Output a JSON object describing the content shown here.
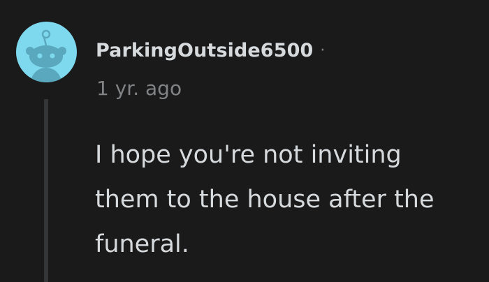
{
  "comment": {
    "username": "ParkingOutside6500",
    "separator": "·",
    "timestamp": "1 yr. ago",
    "body": "I hope you're not inviting them to the house after the funeral.",
    "avatar_icon": "snoo-avatar-icon"
  },
  "colors": {
    "background": "#1a1a1b",
    "avatar_bg": "#7ed8ee",
    "avatar_snoo": "#5aa8bd",
    "text_primary": "#d7dadc",
    "text_secondary": "#818384",
    "thread_line": "#343536"
  }
}
